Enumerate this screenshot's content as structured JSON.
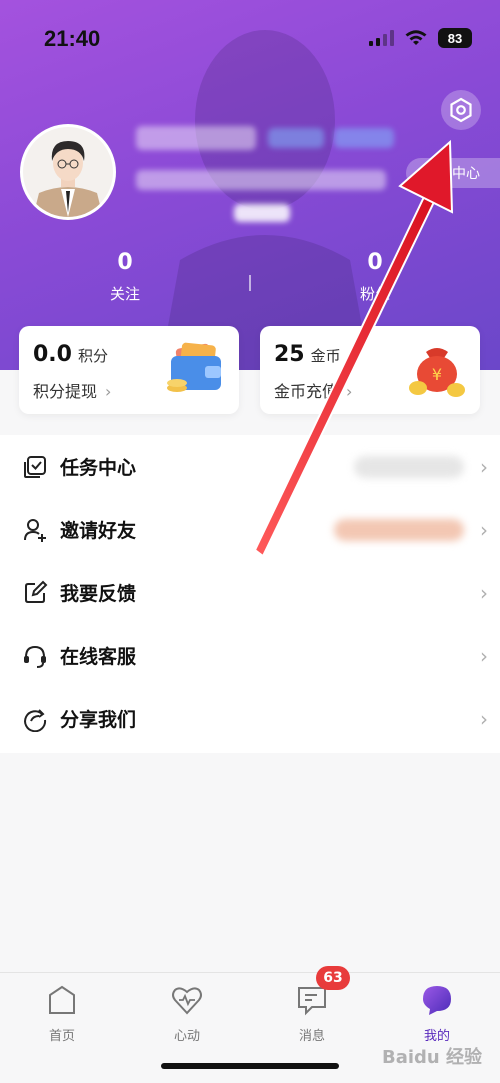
{
  "status_bar": {
    "time": "21:40",
    "battery": "83"
  },
  "profile": {
    "center_label": "中心"
  },
  "stats": [
    {
      "value": "0",
      "label": "关注"
    },
    {
      "value": "0",
      "label": "粉丝"
    }
  ],
  "cards": {
    "points": {
      "value": "0.0",
      "unit": "积分",
      "action": "积分提现"
    },
    "coins": {
      "value": "25",
      "unit": "金币",
      "action": "金币充值"
    }
  },
  "menu": [
    {
      "label": "任务中心",
      "icon": "task-check-icon"
    },
    {
      "label": "邀请好友",
      "icon": "add-user-icon"
    },
    {
      "label": "我要反馈",
      "icon": "edit-icon"
    },
    {
      "label": "在线客服",
      "icon": "headset-icon"
    },
    {
      "label": "分享我们",
      "icon": "share-icon"
    }
  ],
  "tabs": [
    {
      "label": "首页",
      "icon": "home-icon"
    },
    {
      "label": "心动",
      "icon": "heart-pulse-icon"
    },
    {
      "label": "消息",
      "icon": "message-icon",
      "badge": "63"
    },
    {
      "label": "我的",
      "icon": "me-bubble-icon"
    }
  ],
  "watermark": "Baidu 经验",
  "colors": {
    "header_start": "#a452de",
    "header_end": "#6b47c9",
    "accent": "#5a2bbd",
    "badge": "#e83b3b",
    "arrow": "#e0182a"
  }
}
